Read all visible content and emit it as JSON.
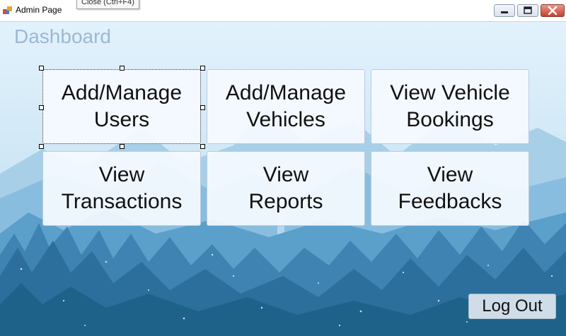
{
  "window": {
    "title": "Admin Page",
    "tooltip": "Close (Ctrl+F4)"
  },
  "page": {
    "title": "Dashboard"
  },
  "tiles": [
    {
      "line1": "Add/Manage",
      "line2": "Users"
    },
    {
      "line1": "Add/Manage",
      "line2": "Vehicles"
    },
    {
      "line1": "View Vehicle",
      "line2": "Bookings"
    },
    {
      "line1": "View",
      "line2": "Transactions"
    },
    {
      "line1": "View",
      "line2": "Reports"
    },
    {
      "line1": "View",
      "line2": "Feedbacks"
    }
  ],
  "logout_label": "Log Out",
  "icons": {
    "app": "app-icon",
    "minimize": "minimize-icon",
    "maximize": "maximize-icon",
    "close": "close-icon"
  },
  "colors": {
    "title": "#9bb9d4",
    "tile_bg": "#f5faff",
    "close_button": "#c4402f",
    "background_sky": "#dbeefa",
    "forest_dark": "#1f6289"
  }
}
